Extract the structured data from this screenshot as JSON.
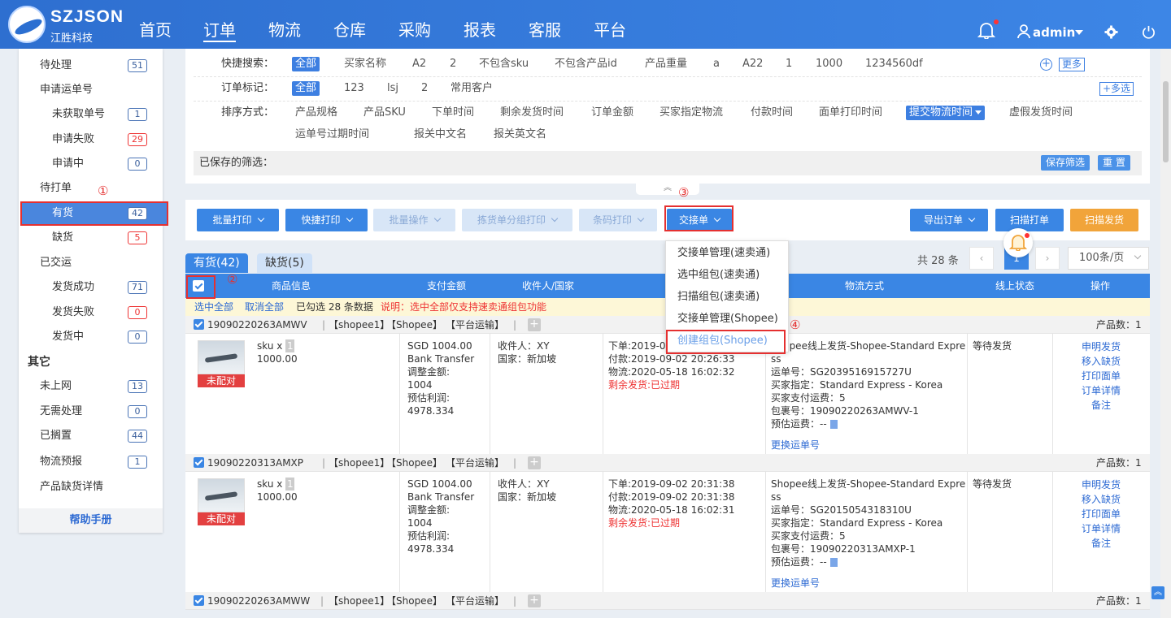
{
  "header": {
    "brand": "SZJSON",
    "brand_sub": "江胜科技",
    "nav": [
      "首页",
      "订单",
      "物流",
      "仓库",
      "采购",
      "报表",
      "客服",
      "平台"
    ],
    "user": "admin"
  },
  "sidebar": {
    "items": [
      {
        "label": "待处理",
        "badge": "51",
        "indent": false,
        "red": false
      },
      {
        "label": "申请运单号",
        "badge": "",
        "indent": false,
        "red": false
      },
      {
        "label": "未获取单号",
        "badge": "1",
        "indent": true,
        "red": false
      },
      {
        "label": "申请失败",
        "badge": "29",
        "indent": true,
        "red": true
      },
      {
        "label": "申请中",
        "badge": "0",
        "indent": true,
        "red": false
      },
      {
        "label": "待打单",
        "badge": "",
        "indent": false,
        "red": false
      },
      {
        "label": "有货",
        "badge": "42",
        "indent": true,
        "red": false
      },
      {
        "label": "缺货",
        "badge": "5",
        "indent": true,
        "red": true
      },
      {
        "label": "已交运",
        "badge": "",
        "indent": false,
        "red": false
      },
      {
        "label": "发货成功",
        "badge": "71",
        "indent": true,
        "red": false
      },
      {
        "label": "发货失败",
        "badge": "0",
        "indent": true,
        "red": true
      },
      {
        "label": "发货中",
        "badge": "0",
        "indent": true,
        "red": false
      },
      {
        "label": "其它",
        "badge": "",
        "indent": false,
        "red": false
      },
      {
        "label": "未上网",
        "badge": "13",
        "indent": false,
        "red": false
      },
      {
        "label": "无需处理",
        "badge": "0",
        "indent": false,
        "red": false
      },
      {
        "label": "已搁置",
        "badge": "44",
        "indent": false,
        "red": false
      },
      {
        "label": "物流预报",
        "badge": "1",
        "indent": false,
        "red": false
      },
      {
        "label": "产品缺货详情",
        "badge": "",
        "indent": false,
        "red": false
      }
    ],
    "help": "帮助手册"
  },
  "filter": {
    "quick_label": "快捷搜索：",
    "quick_items": [
      "全部",
      "买家名称",
      "A2",
      "2",
      "不包含sku",
      "不包含产品id",
      "产品重量",
      "a",
      "A22",
      "1",
      "1000",
      "1234560df"
    ],
    "more": "更多",
    "mark_label": "订单标记：",
    "mark_items": [
      "全部",
      "123",
      "lsj",
      "2",
      "常用客户"
    ],
    "multi": "+多选",
    "sort_label": "排序方式：",
    "sort_items": [
      "产品规格",
      "产品SKU",
      "下单时间",
      "剩余发货时间",
      "订单金额",
      "买家指定物流",
      "付款时间",
      "面单打印时间",
      "提交物流时间",
      "虚假发货时间"
    ],
    "sort_items2": [
      "运单号过期时间",
      "报关中文名",
      "报关英文名"
    ],
    "saved_label": "已保存的筛选：",
    "save_btn": "保存筛选",
    "reset_btn": "重 置"
  },
  "toolbar": {
    "buttons": [
      "批量打印",
      "快捷打印",
      "批量操作",
      "拣货单分组打印",
      "条码打印",
      "交接单"
    ],
    "right": [
      "导出订单",
      "扫描打单",
      "扫描发货"
    ]
  },
  "dropdown": [
    "交接单管理(速卖通)",
    "选中组包(速卖通)",
    "扫描组包(速卖通)",
    "交接单管理(Shopee)",
    "创建组包(Shopee)"
  ],
  "tabs": [
    "有货(42)",
    "缺货(5)"
  ],
  "pagination": {
    "total": "共 28 条",
    "page": "1",
    "per_page": "100条/页"
  },
  "table": {
    "headers": [
      "商品信息",
      "支付金额",
      "收件人/国家",
      "物流方式",
      "线上状态",
      "操作"
    ],
    "notice": {
      "select_all": "选中全部",
      "deselect": "取消全部",
      "count": "已勾选 28 条数据",
      "tip": "说明：选中全部仅支持速卖通组包功能"
    },
    "orders": [
      {
        "id": "19090220263AMWV",
        "shop": "【shopee1】",
        "platform": "【Shopee】",
        "ship": "【平台运输】",
        "count": "产品数：1",
        "tag": "未配对",
        "sku": "sku  x",
        "qty": "1",
        "price": "1000.00",
        "pay": [
          "SGD  1004.00",
          "Bank Transfer",
          "调整金额:",
          "1004",
          "预估利润:",
          "4978.334"
        ],
        "recv": [
          "收件人：XY",
          "国家：新加坡"
        ],
        "time": [
          "下单:2019-09-02 20:26:33",
          "付款:2019-09-02 20:26:33",
          "物流:2020-05-18 16:02:32"
        ],
        "remain": "剩余发货:已过期",
        "logi": [
          "Shopee线上发货-Shopee-Standard Expre",
          "ss",
          "运单号：SG2039516915727U",
          "买家指定：Standard Express - Korea",
          "买家支付运费：5",
          "包裹号：19090220263AMWV-1"
        ],
        "fee": "预估运费：--",
        "change": "更换运单号",
        "status": "等待发货",
        "ops": [
          "申明发货",
          "移入缺货",
          "打印面单",
          "订单详情",
          "备注"
        ]
      },
      {
        "id": "19090220313AMXP",
        "shop": "【shopee1】",
        "platform": "【Shopee】",
        "ship": "【平台运输】",
        "count": "产品数：1",
        "tag": "未配对",
        "sku": "sku  x",
        "qty": "1",
        "price": "1000.00",
        "pay": [
          "SGD  1004.00",
          "Bank Transfer",
          "调整金额:",
          "1004",
          "预估利润:",
          "4978.334"
        ],
        "recv": [
          "收件人：XY",
          "国家：新加坡"
        ],
        "time": [
          "下单:2019-09-02 20:31:38",
          "付款:2019-09-02 20:31:38",
          "物流:2020-05-18 16:02:31"
        ],
        "remain": "剩余发货:已过期",
        "logi": [
          "Shopee线上发货-Shopee-Standard Expre",
          "ss",
          "运单号：SG2015054318310U",
          "买家指定：Standard Express - Korea",
          "买家支付运费：5",
          "包裹号：19090220313AMXP-1"
        ],
        "fee": "预估运费：--",
        "change": "更换运单号",
        "status": "等待发货",
        "ops": [
          "申明发货",
          "移入缺货",
          "打印面单",
          "订单详情",
          "备注"
        ]
      },
      {
        "id": "19090220263AMWW",
        "shop": "【shopee1】",
        "platform": "【Shopee】",
        "ship": "【平台运输】",
        "count": "产品数：1"
      }
    ]
  },
  "annotations": [
    "①",
    "②",
    "③",
    "④"
  ],
  "colors": {
    "primary": "#3a86e4",
    "header": "#2e6fd0",
    "danger": "#e53030",
    "warning": "#f1a43a"
  }
}
